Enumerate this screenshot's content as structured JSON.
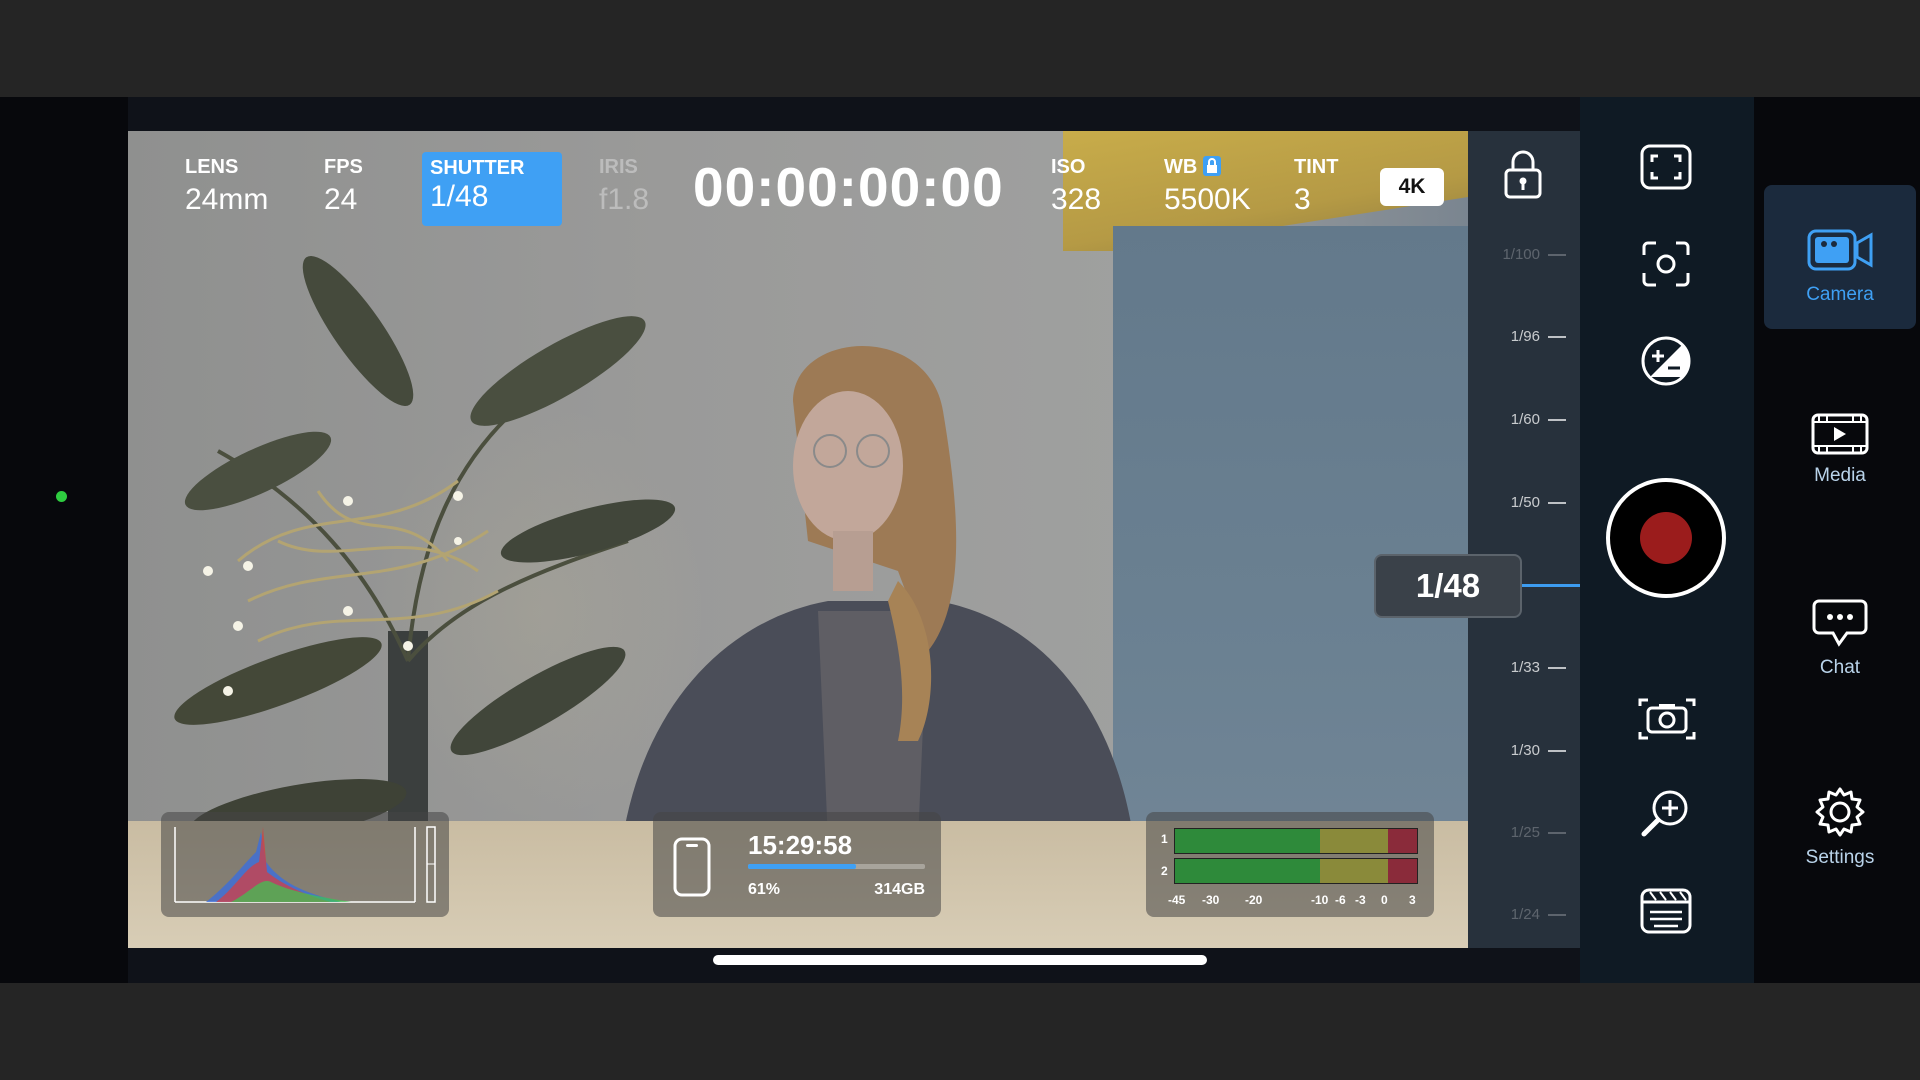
{
  "params": {
    "lens": {
      "label": "LENS",
      "value": "24mm"
    },
    "fps": {
      "label": "FPS",
      "value": "24"
    },
    "shutter": {
      "label": "SHUTTER",
      "value": "1/48"
    },
    "iris": {
      "label": "IRIS",
      "value": "f1.8"
    },
    "iso": {
      "label": "ISO",
      "value": "328"
    },
    "wb": {
      "label": "WB",
      "value": "5500K"
    },
    "tint": {
      "label": "TINT",
      "value": "3"
    },
    "resolution_badge": "4K"
  },
  "timecode": "00:00:00:00",
  "shutter_picker": {
    "selected": "1/48",
    "ticks": [
      "1/100",
      "1/96",
      "1/60",
      "1/50",
      "1/33",
      "1/30",
      "1/25",
      "1/24"
    ]
  },
  "storage": {
    "record_time_remaining": "15:29:58",
    "percent_label": "61%",
    "percent_used": 0.61,
    "capacity": "314GB"
  },
  "audio_meter": {
    "channels": [
      "1",
      "2"
    ],
    "scale": [
      "-45",
      "-30",
      "-20",
      "-10",
      "-6",
      "-3",
      "0",
      "3"
    ]
  },
  "controls": [
    "fullscreen-icon",
    "focus-icon",
    "exposure-compensation-icon",
    "record-button",
    "photo-capture-icon",
    "zoom-in-icon",
    "slate-icon"
  ],
  "nav": {
    "camera": "Camera",
    "media": "Media",
    "chat": "Chat",
    "settings": "Settings"
  },
  "colors": {
    "accent": "#3fa0f4",
    "record": "#9b1c1c",
    "status_dot": "#2ecc40"
  }
}
